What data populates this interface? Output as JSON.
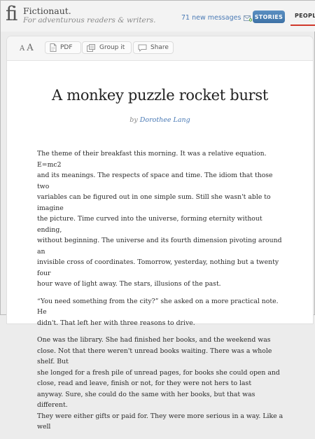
{
  "header": {
    "logo_glyph": "fi",
    "site_name": "Fictionaut.",
    "tagline": "For adventurous readers & writers.",
    "messages_label": "71 new messages",
    "stories_button": "STORIES",
    "people_tab": "PEOPLE"
  },
  "toolbar": {
    "font_small": "A",
    "font_large": "A",
    "pdf_label": "PDF",
    "group_label": "Group it",
    "share_label": "Share"
  },
  "story": {
    "title": "A monkey puzzle rocket burst",
    "by": "by",
    "author": "Dorothee Lang",
    "paragraphs": [
      "The theme of their breakfast this morning. It was a relative equation. E=mc2\nand its meanings. The respects of space and time. The idiom that those two\nvariables can be figured out in one simple sum. Still she wasn't able to imagine\nthe picture. Time curved into the universe, forming eternity without ending,\nwithout beginning. The universe and its fourth dimension pivoting around an\ninvisible cross of coordinates. Tomorrow, yesterday, nothing but a twenty four\nhour wave of light away. The stars, illusions of the past.",
      "“You need something from the city?” she asked on a more practical note. He\ndidn't. That left her with three reasons to drive.",
      "One was the library. She had finished her books, and the weekend was\nclose. Not that there weren't unread books waiting. There was a whole shelf. But\nshe longed for a fresh pile of unread pages, for books she could open and\nclose, read and leave, finish or not, for they were not hers to last\nanyway. Sure, she could do the same with her books, but that was different.\nThey were either gifts or paid for. They were more serious in a way. Like a well"
    ]
  },
  "colors": {
    "accent_link": "#4a7ab5",
    "stories_button_bg": "#4a7fb3",
    "people_underline": "#d0382b"
  },
  "icons": {
    "messages": "envelope-plus-icon",
    "pdf": "document-icon",
    "group": "group-icon",
    "share": "speech-bubble-icon"
  }
}
